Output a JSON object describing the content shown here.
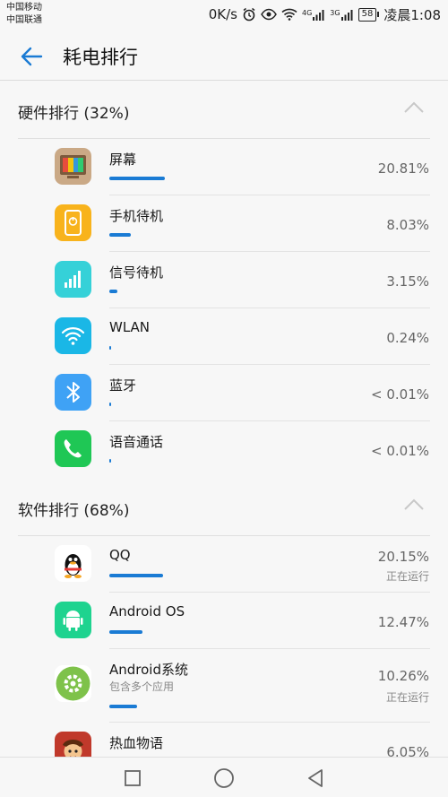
{
  "status_bar": {
    "carrier1": "中国移动",
    "carrier2": "中国联通",
    "speed": "0K/s",
    "net1": "4G",
    "net2": "3G",
    "battery": "58",
    "time": "凌晨1:08",
    "icons": [
      "alarm-icon",
      "eye-icon",
      "wifi-icon",
      "signal-icon",
      "signal-icon",
      "battery-icon"
    ]
  },
  "app_bar": {
    "back_icon": "arrow-left-icon",
    "title": "耗电排行"
  },
  "colors": {
    "accent": "#1a7bd4",
    "progress_bar": "#1a7bd4"
  },
  "hardware": {
    "title": "硬件排行 (32%)",
    "collapse_icon": "chevron-up-icon",
    "items": [
      {
        "name": "屏幕",
        "percent": "20.81%",
        "bar_fraction": 0.2081,
        "icon": "screen-icon",
        "icon_color": "#caa986"
      },
      {
        "name": "手机待机",
        "percent": "8.03%",
        "bar_fraction": 0.0803,
        "icon": "phone-standby-icon",
        "icon_color": "#f8b31c"
      },
      {
        "name": "信号待机",
        "percent": "3.15%",
        "bar_fraction": 0.0315,
        "icon": "signal-bars-icon",
        "icon_color": "#35d1d8"
      },
      {
        "name": "WLAN",
        "percent": "0.24%",
        "bar_fraction": 0.0024,
        "icon": "wifi-icon",
        "icon_color": "#1ab7e6"
      },
      {
        "name": "蓝牙",
        "percent": "< 0.01%",
        "bar_fraction": 0.0001,
        "icon": "bluetooth-icon",
        "icon_color": "#3fa2f5"
      },
      {
        "name": "语音通话",
        "percent": "< 0.01%",
        "bar_fraction": 0.0001,
        "icon": "phone-icon",
        "icon_color": "#1fc755"
      }
    ]
  },
  "software": {
    "title": "软件排行 (68%)",
    "collapse_icon": "chevron-up-icon",
    "items": [
      {
        "name": "QQ",
        "percent": "20.15%",
        "state": "正在运行",
        "bar_fraction": 0.2015,
        "icon": "qq-penguin-icon",
        "icon_color": "#ffffff"
      },
      {
        "name": "Android OS",
        "percent": "12.47%",
        "bar_fraction": 0.1247,
        "icon": "android-icon",
        "icon_color": "#1ed38f"
      },
      {
        "name": "Android系统",
        "sub": "包含多个应用",
        "percent": "10.26%",
        "state": "正在运行",
        "bar_fraction": 0.1026,
        "icon": "gear-icon",
        "icon_color": "#7ec24a"
      },
      {
        "name": "热血物语",
        "percent": "6.05%",
        "bar_fraction": 0.0605,
        "icon": "game-icon",
        "icon_color": "#c0392b"
      }
    ]
  },
  "nav_bar": {
    "recents_icon": "square-icon",
    "home_icon": "circle-icon",
    "back_icon": "triangle-back-icon"
  }
}
